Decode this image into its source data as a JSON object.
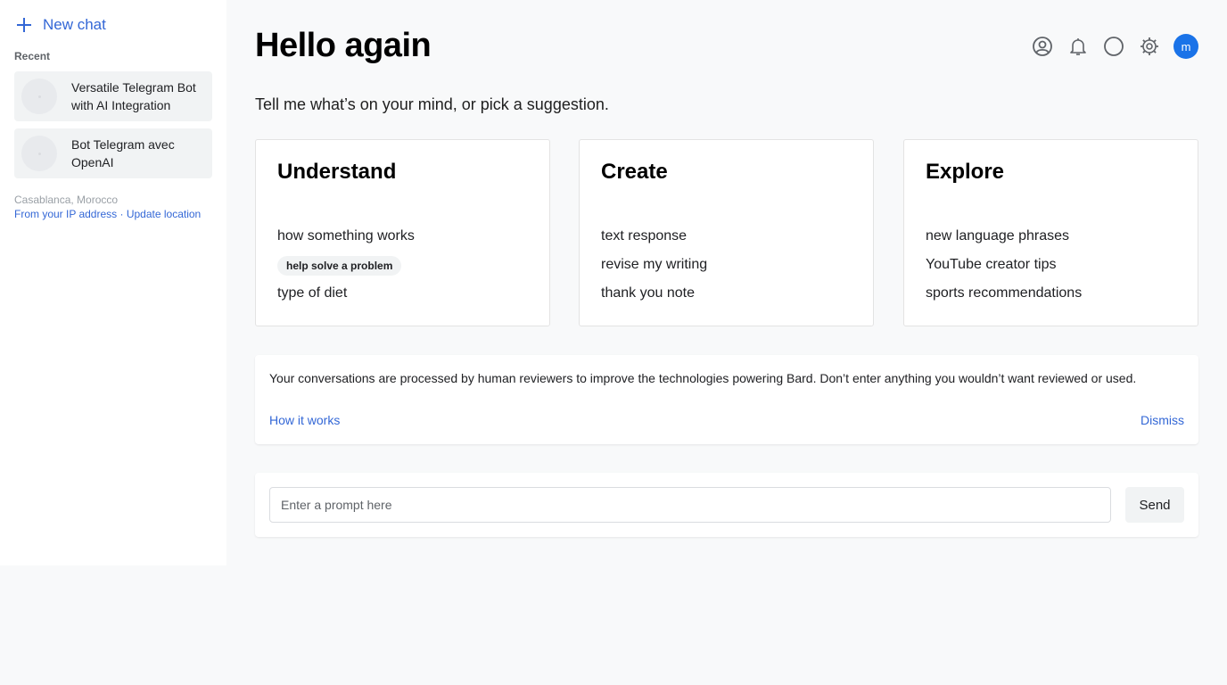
{
  "sidebar": {
    "new_chat_label": "New chat",
    "recent_label": "Recent",
    "chats": [
      {
        "title": "Versatile Telegram Bot with AI Integration"
      },
      {
        "title": "Bot Telegram avec OpenAI"
      }
    ],
    "location": {
      "city": "Casablanca, Morocco",
      "ip_link": "From your IP address",
      "separator": " · ",
      "update_link": "Update location"
    }
  },
  "header": {
    "greeting": "Hello again",
    "avatar_letter": "m",
    "icons": [
      "account-icon",
      "bell-icon",
      "circle-icon",
      "gear-icon"
    ]
  },
  "main": {
    "subtitle": "Tell me what’s on your mind, or pick a suggestion.",
    "cards": [
      {
        "title": "Understand",
        "items": [
          "how something works",
          "help solve a problem",
          "type of diet"
        ]
      },
      {
        "title": "Create",
        "items": [
          "text response",
          "revise my writing",
          "thank you note"
        ]
      },
      {
        "title": "Explore",
        "items": [
          "new language phrases",
          "YouTube creator tips",
          "sports recommendations"
        ]
      }
    ],
    "notice": {
      "message": "Your conversations are processed by human reviewers to improve the technologies powering Bard. Don’t enter anything you wouldn’t want reviewed or used.",
      "how_it_works": "How it works",
      "dismiss": "Dismiss"
    },
    "prompt": {
      "placeholder": "Enter a prompt here",
      "value": "",
      "send_label": "Send"
    }
  },
  "colors": {
    "accent": "#3367d6",
    "avatar_bg": "#1a73e8",
    "page_bg": "#f8f9fa"
  }
}
